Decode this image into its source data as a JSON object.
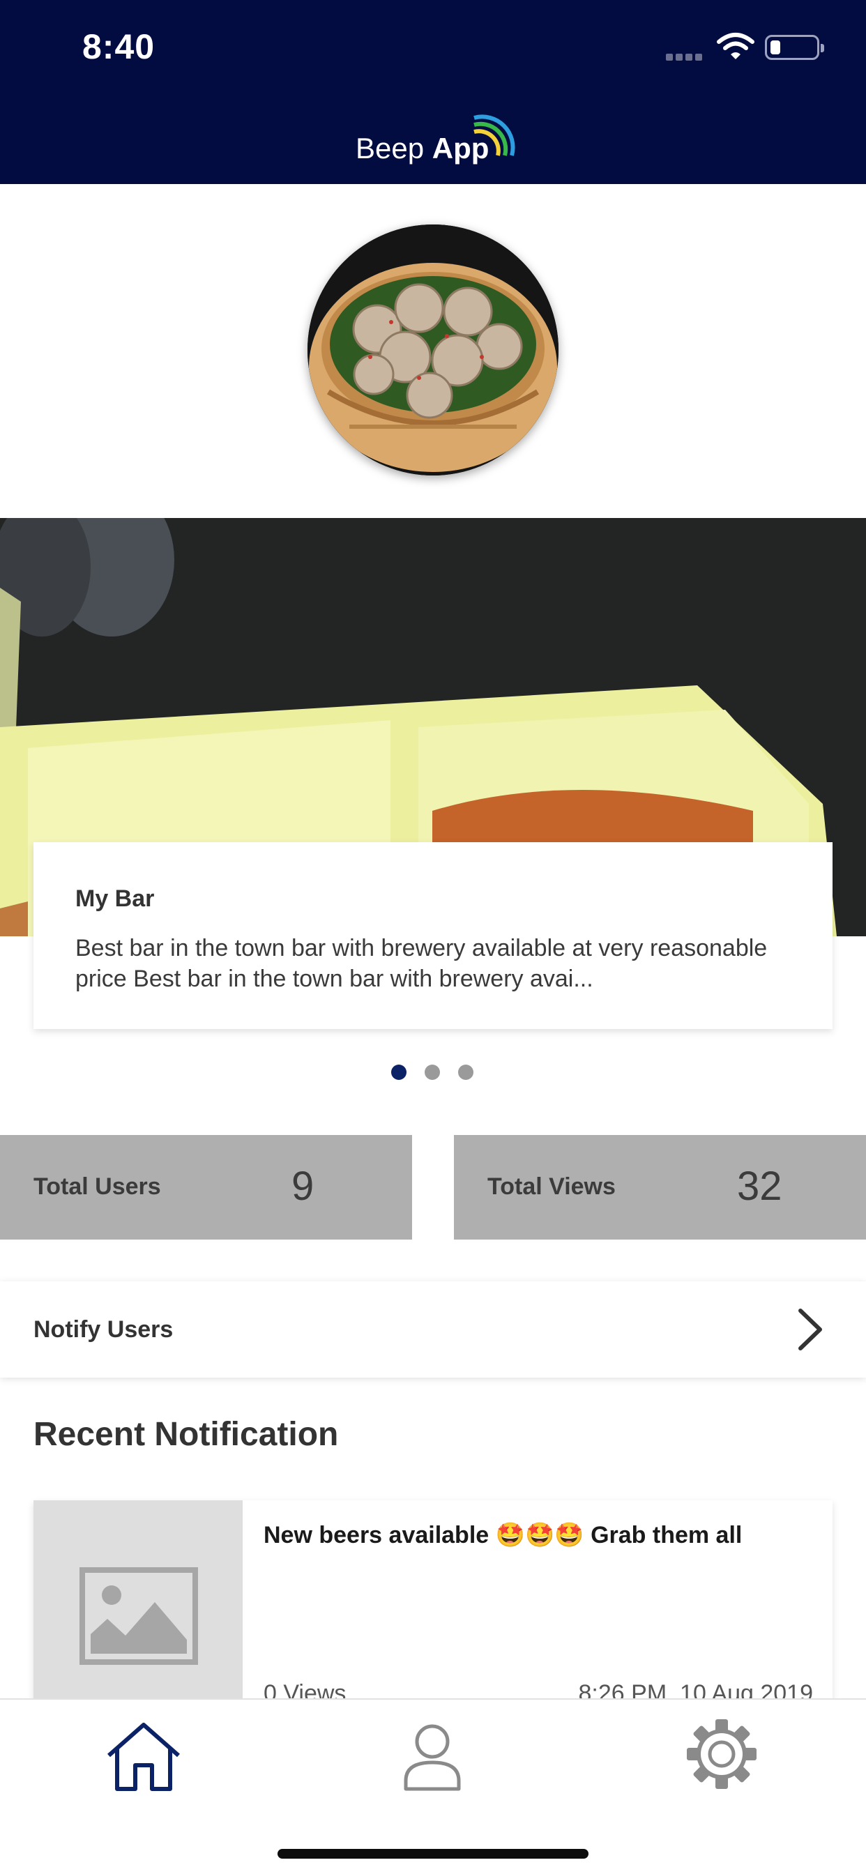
{
  "status_bar": {
    "time": "8:40"
  },
  "header": {
    "logo_word1": "Beep",
    "logo_word2": "App",
    "background_color": "#030c40",
    "logo_arc_colors": [
      "#2d9ee0",
      "#38b84a",
      "#f2d13a"
    ]
  },
  "banner": {
    "carousel_total": 3,
    "carousel_active_index": 0,
    "card": {
      "title": "My Bar",
      "description": "Best bar in the town bar with brewery available at very reasonable price Best bar in the town bar with brewery avai..."
    }
  },
  "stats": {
    "users": {
      "label": "Total Users",
      "value": "9"
    },
    "views": {
      "label": "Total Views",
      "value": "32"
    }
  },
  "notify": {
    "label": "Notify Users"
  },
  "recent": {
    "title": "Recent Notification",
    "items": [
      {
        "title": "New beers available 🤩🤩🤩 Grab them all",
        "views": "0 Views",
        "date": "8:26 PM, 10 Aug 2019"
      }
    ]
  },
  "tabbar": {
    "items": [
      {
        "icon": "home-icon",
        "active": true
      },
      {
        "icon": "user-icon",
        "active": false
      },
      {
        "icon": "gear-icon",
        "active": false
      }
    ],
    "active_color": "#0b2266",
    "inactive_color": "#8a8a8a"
  }
}
